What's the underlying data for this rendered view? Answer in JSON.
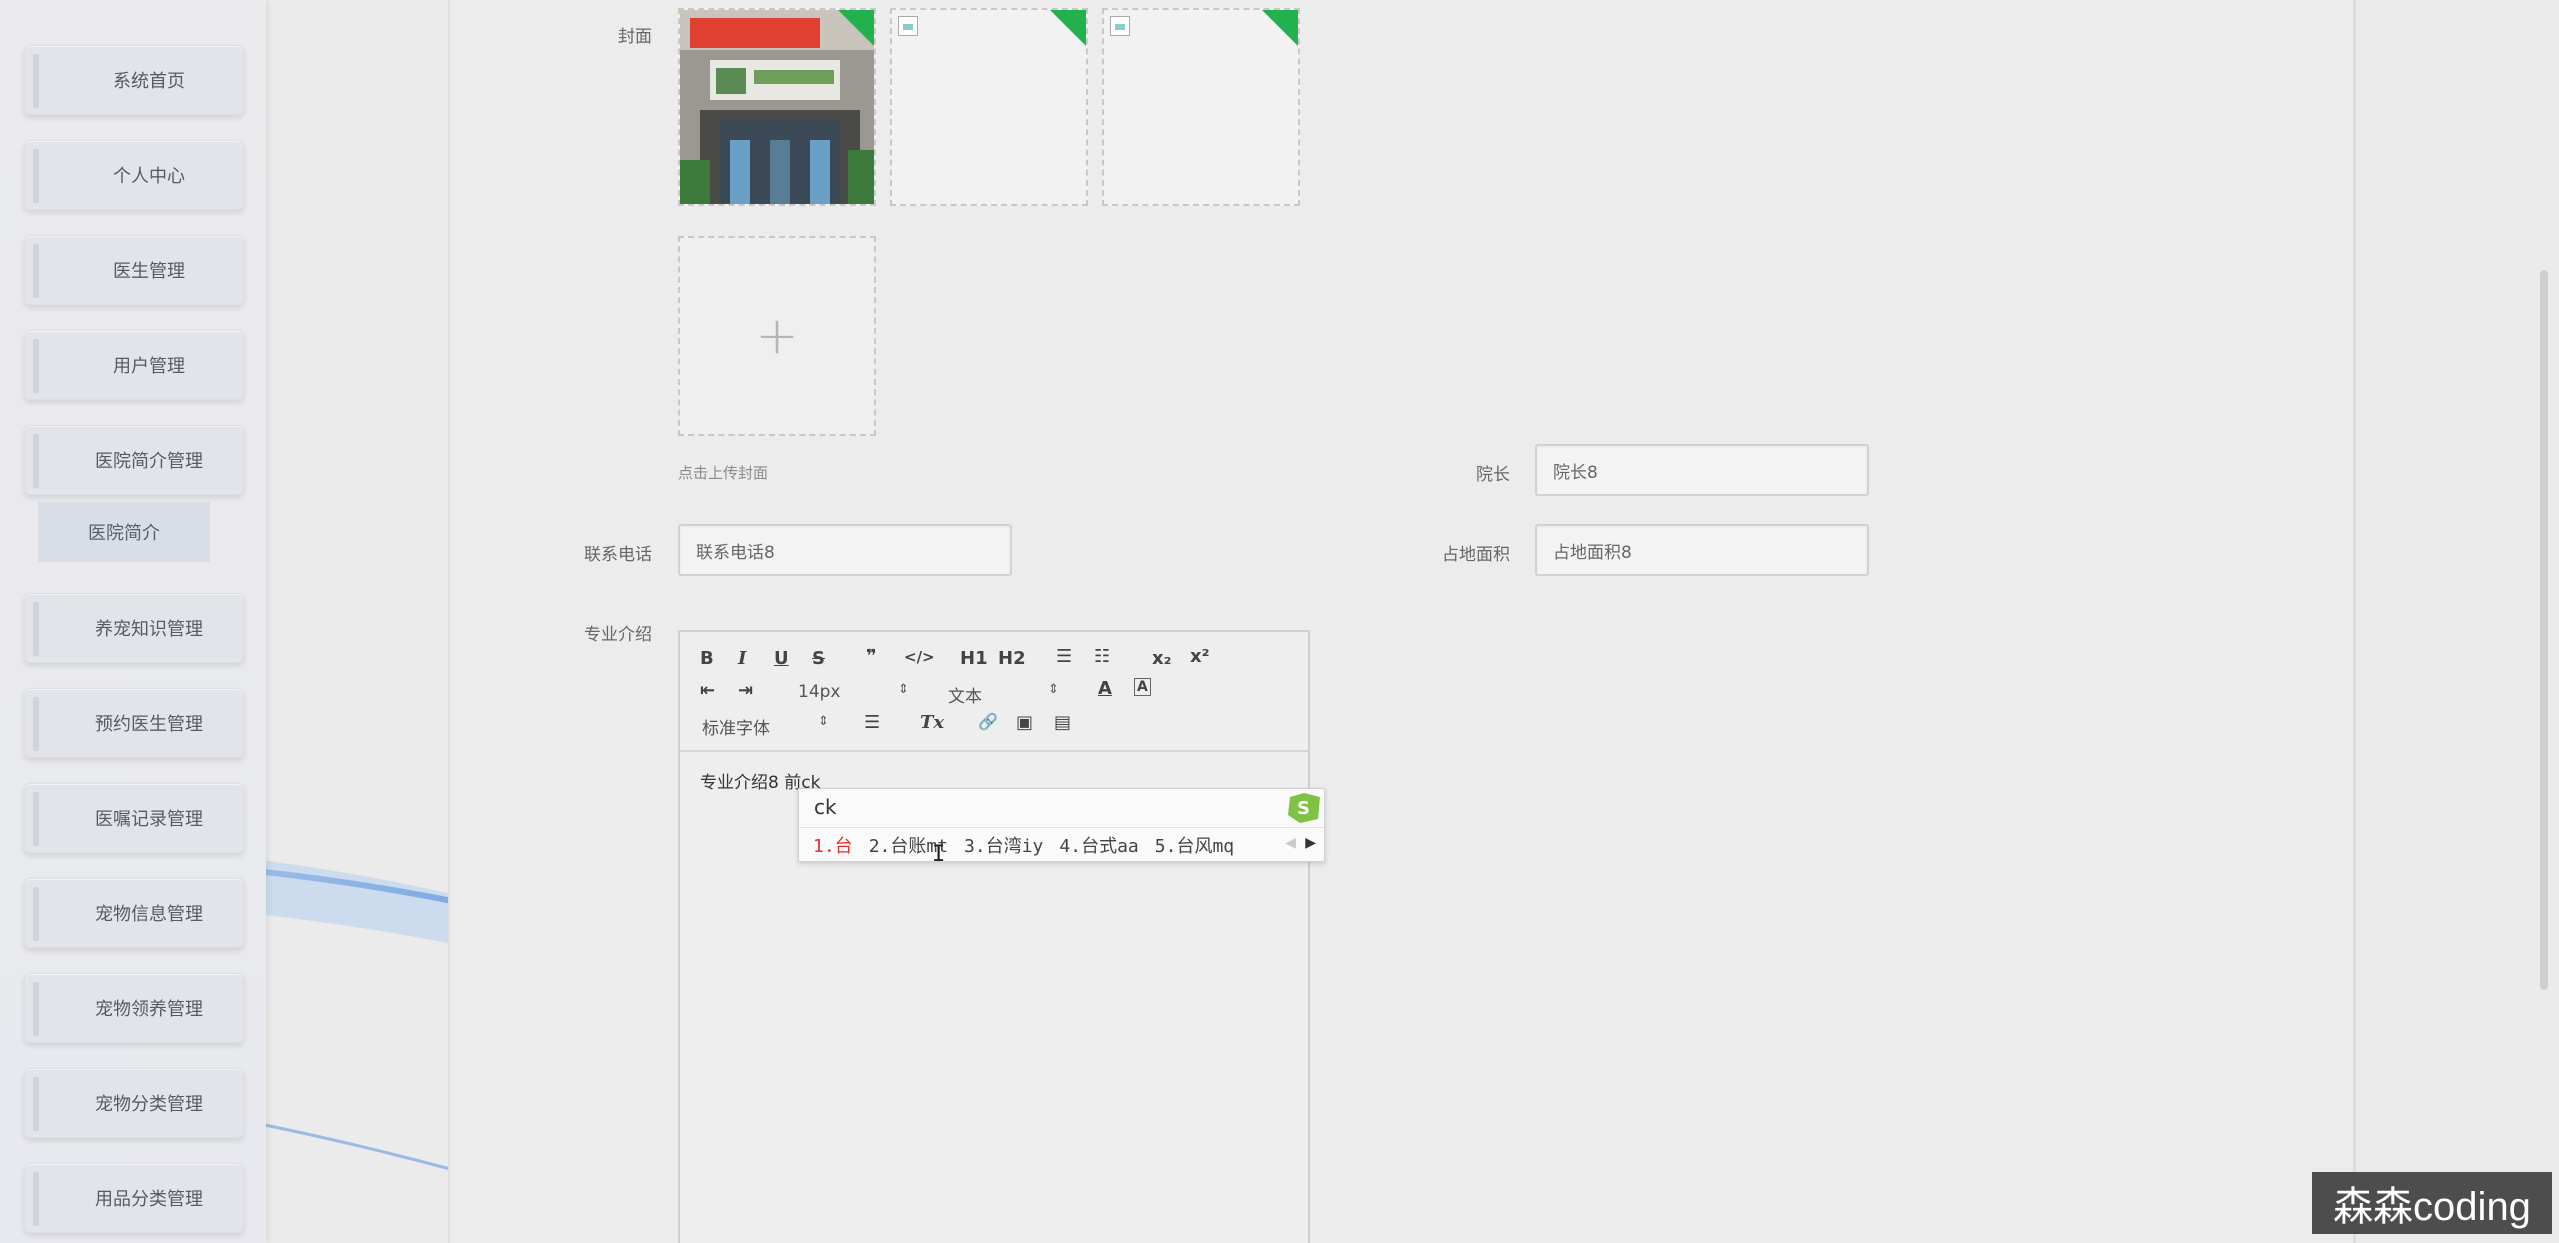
{
  "sidebar": {
    "items": [
      {
        "label": "系统首页"
      },
      {
        "label": "个人中心"
      },
      {
        "label": "医生管理"
      },
      {
        "label": "用户管理"
      },
      {
        "label": "医院简介管理"
      },
      {
        "label": "养宠知识管理"
      },
      {
        "label": "预约医生管理"
      },
      {
        "label": "医嘱记录管理"
      },
      {
        "label": "宠物信息管理"
      },
      {
        "label": "宠物领养管理"
      },
      {
        "label": "宠物分类管理"
      },
      {
        "label": "用品分类管理"
      }
    ],
    "sub_item": {
      "label": "医院简介"
    }
  },
  "form": {
    "cover_label": "封面",
    "cover_hint": "点击上传封面",
    "dean_label": "院长",
    "dean_value": "院长8",
    "phone_label": "联系电话",
    "phone_value": "联系电话8",
    "area_label": "占地面积",
    "area_value": "占地面积8",
    "intro_label": "专业介绍",
    "upload_plus": "+"
  },
  "editor": {
    "toolbar": {
      "bold": "B",
      "italic": "I",
      "underline": "U",
      "strike": "S",
      "quote": "❞",
      "code": "</>",
      "h1": "H1",
      "h2": "H2",
      "ordered_list": "☰",
      "bullet_list": "☷",
      "subscript": "x₂",
      "superscript": "x²",
      "outdent": "⇤",
      "indent": "⇥",
      "font_size": "14px",
      "text_type": "文本",
      "font_color": "A",
      "bg_color": "A",
      "font_family": "标准字体",
      "align": "☰",
      "clear_format": "Tx",
      "link": "🔗",
      "image": "▣",
      "video": "▤",
      "select_arrow": "⇕"
    },
    "content": "专业介绍8 前ck"
  },
  "ime": {
    "input": "ck",
    "candidates": [
      "1.台",
      "2.台账mt",
      "3.台湾iy",
      "4.台式aa",
      "5.台风mq"
    ],
    "next": "▶",
    "prev": "◀"
  },
  "watermark": "森森coding",
  "colors": {
    "accent_green": "#22b14c",
    "ime_highlight": "#e0302c",
    "wave_blue": "#3a7fd8"
  }
}
